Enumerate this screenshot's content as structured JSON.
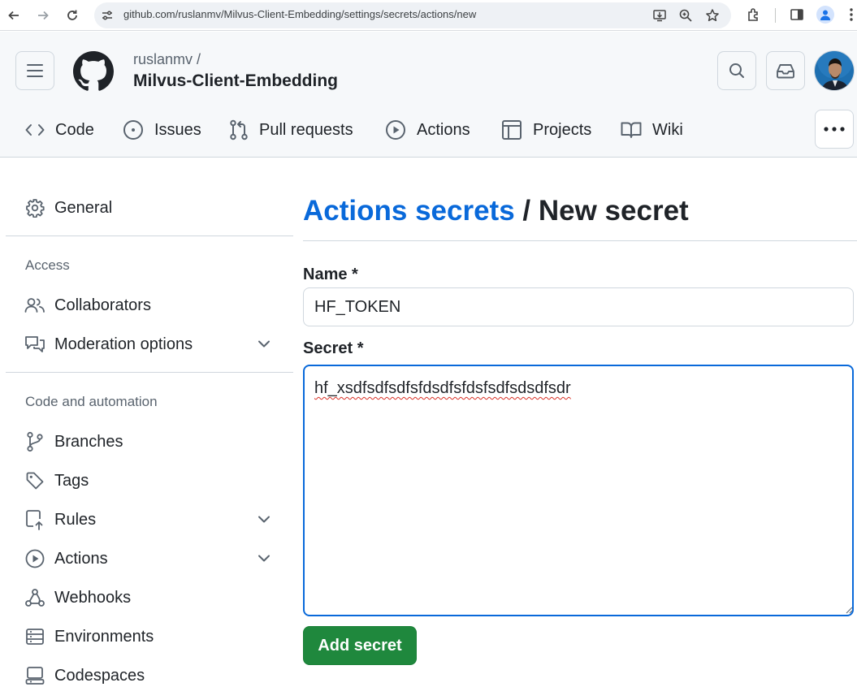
{
  "browser": {
    "url": "github.com/ruslanmv/Milvus-Client-Embedding/settings/secrets/actions/new"
  },
  "header": {
    "owner": "ruslanmv /",
    "repo": "Milvus-Client-Embedding"
  },
  "tabs": [
    {
      "label": "Code",
      "icon": "code-icon"
    },
    {
      "label": "Issues",
      "icon": "issue-opened-icon"
    },
    {
      "label": "Pull requests",
      "icon": "git-pull-request-icon"
    },
    {
      "label": "Actions",
      "icon": "play-icon"
    },
    {
      "label": "Projects",
      "icon": "table-icon"
    },
    {
      "label": "Wiki",
      "icon": "book-icon"
    }
  ],
  "sidebar": {
    "general": "General",
    "access_heading": "Access",
    "collaborators": "Collaborators",
    "moderation": "Moderation options",
    "code_heading": "Code and automation",
    "branches": "Branches",
    "tags": "Tags",
    "rules": "Rules",
    "actions": "Actions",
    "webhooks": "Webhooks",
    "environments": "Environments",
    "codespaces": "Codespaces"
  },
  "main": {
    "breadcrumb_link": "Actions secrets",
    "separator": " / ",
    "title": "New secret",
    "name_label": "Name *",
    "name_value": "HF_TOKEN",
    "secret_label": "Secret *",
    "secret_value": "hf_xsdfsdfsdfsfdsdfsfdsfsdfsdsdfsdr",
    "add_button": "Add secret"
  },
  "colors": {
    "link_blue": "#0969da",
    "primary_green": "#1f883d",
    "border": "#d0d7de",
    "header_bg": "#f6f8fa"
  }
}
